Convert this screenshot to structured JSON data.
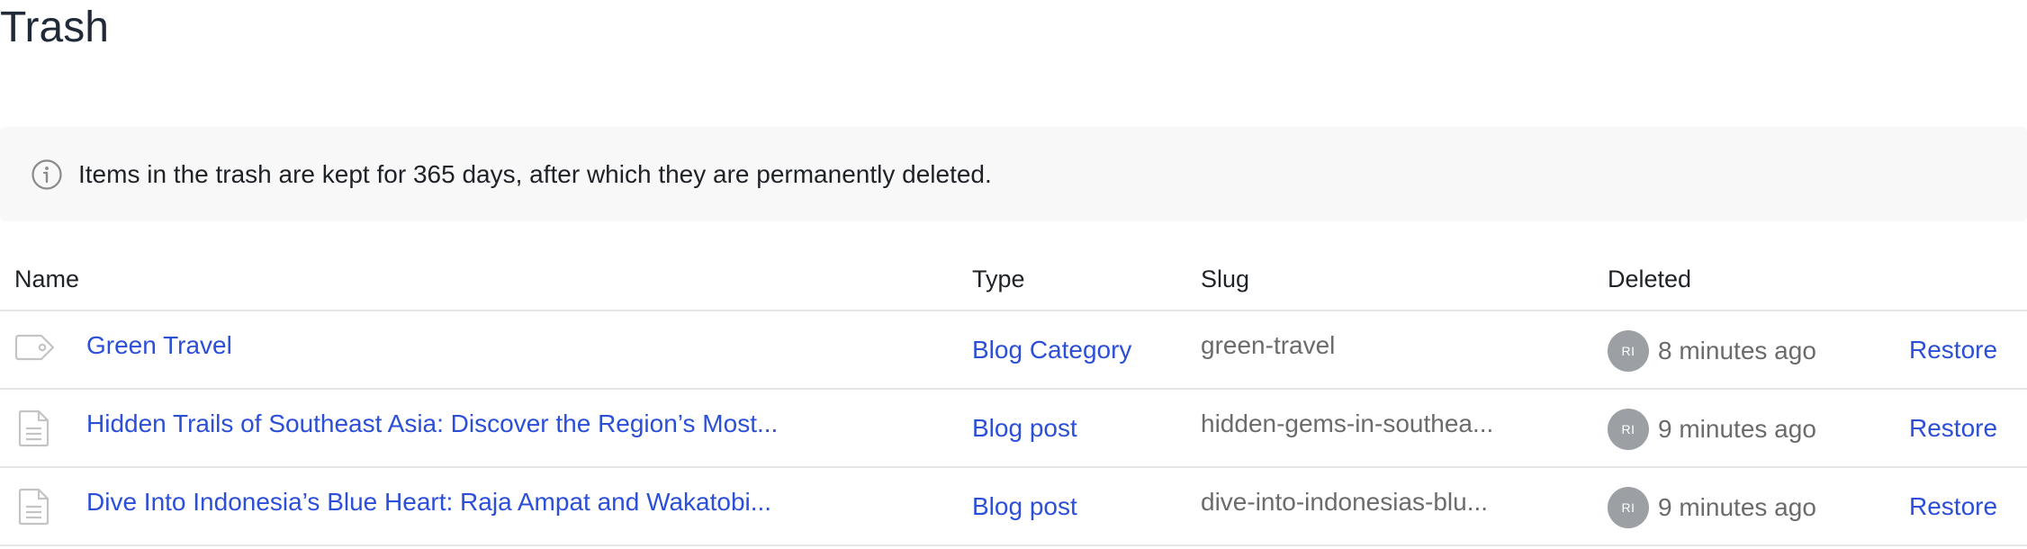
{
  "page": {
    "title": "Trash"
  },
  "notice": {
    "icon": "info-icon",
    "text": "Items in the trash are kept for 365 days, after which they are permanently deleted."
  },
  "table": {
    "columns": {
      "name": "Name",
      "type": "Type",
      "slug": "Slug",
      "deleted": "Deleted"
    },
    "rows": [
      {
        "icon": "tag-icon",
        "name": "Green Travel",
        "type": "Blog Category",
        "slug": "green-travel",
        "avatar": "RI",
        "deleted": "8 minutes ago",
        "action": "Restore"
      },
      {
        "icon": "document-icon",
        "name": "Hidden Trails of Southeast Asia: Discover the Region’s Most...",
        "type": "Blog post",
        "slug": "hidden-gems-in-southea...",
        "avatar": "RI",
        "deleted": "9 minutes ago",
        "action": "Restore"
      },
      {
        "icon": "document-icon",
        "name": "Dive Into Indonesia’s Blue Heart: Raja Ampat and Wakatobi...",
        "type": "Blog post",
        "slug": "dive-into-indonesias-blu...",
        "avatar": "RI",
        "deleted": "9 minutes ago",
        "action": "Restore"
      }
    ]
  },
  "colors": {
    "link": "#2c4fd8",
    "muted_text": "#6b6b6b",
    "notice_bg": "#f8f8f8",
    "avatar_bg": "#9ca0a4",
    "divider": "#e6e6e6"
  }
}
